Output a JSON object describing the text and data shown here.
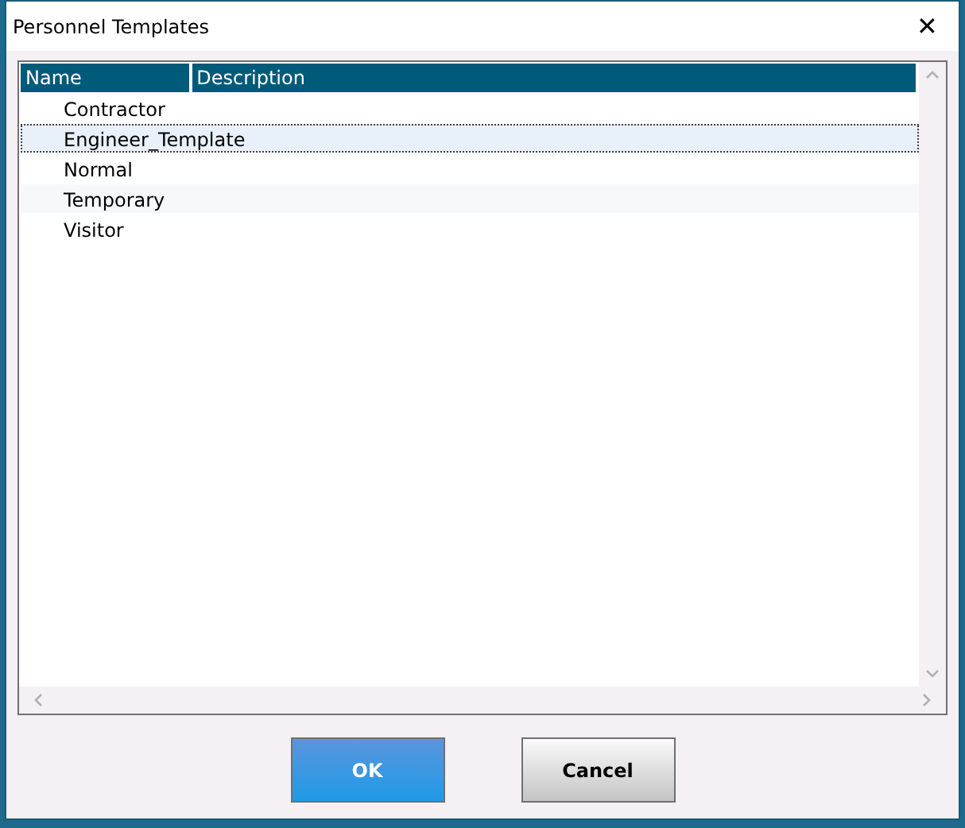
{
  "window": {
    "title": "Personnel Templates",
    "close": "✕"
  },
  "table": {
    "columns": [
      "Name",
      "Description"
    ],
    "rows": [
      {
        "name": "Contractor",
        "selected": false
      },
      {
        "name": "Engineer_Template",
        "selected": true
      },
      {
        "name": "Normal",
        "selected": false
      },
      {
        "name": "Temporary",
        "selected": false
      },
      {
        "name": "Visitor",
        "selected": false
      }
    ]
  },
  "buttons": [
    {
      "label": "OK",
      "kind": "primary"
    },
    {
      "label": "Cancel",
      "kind": "secondary"
    }
  ]
}
